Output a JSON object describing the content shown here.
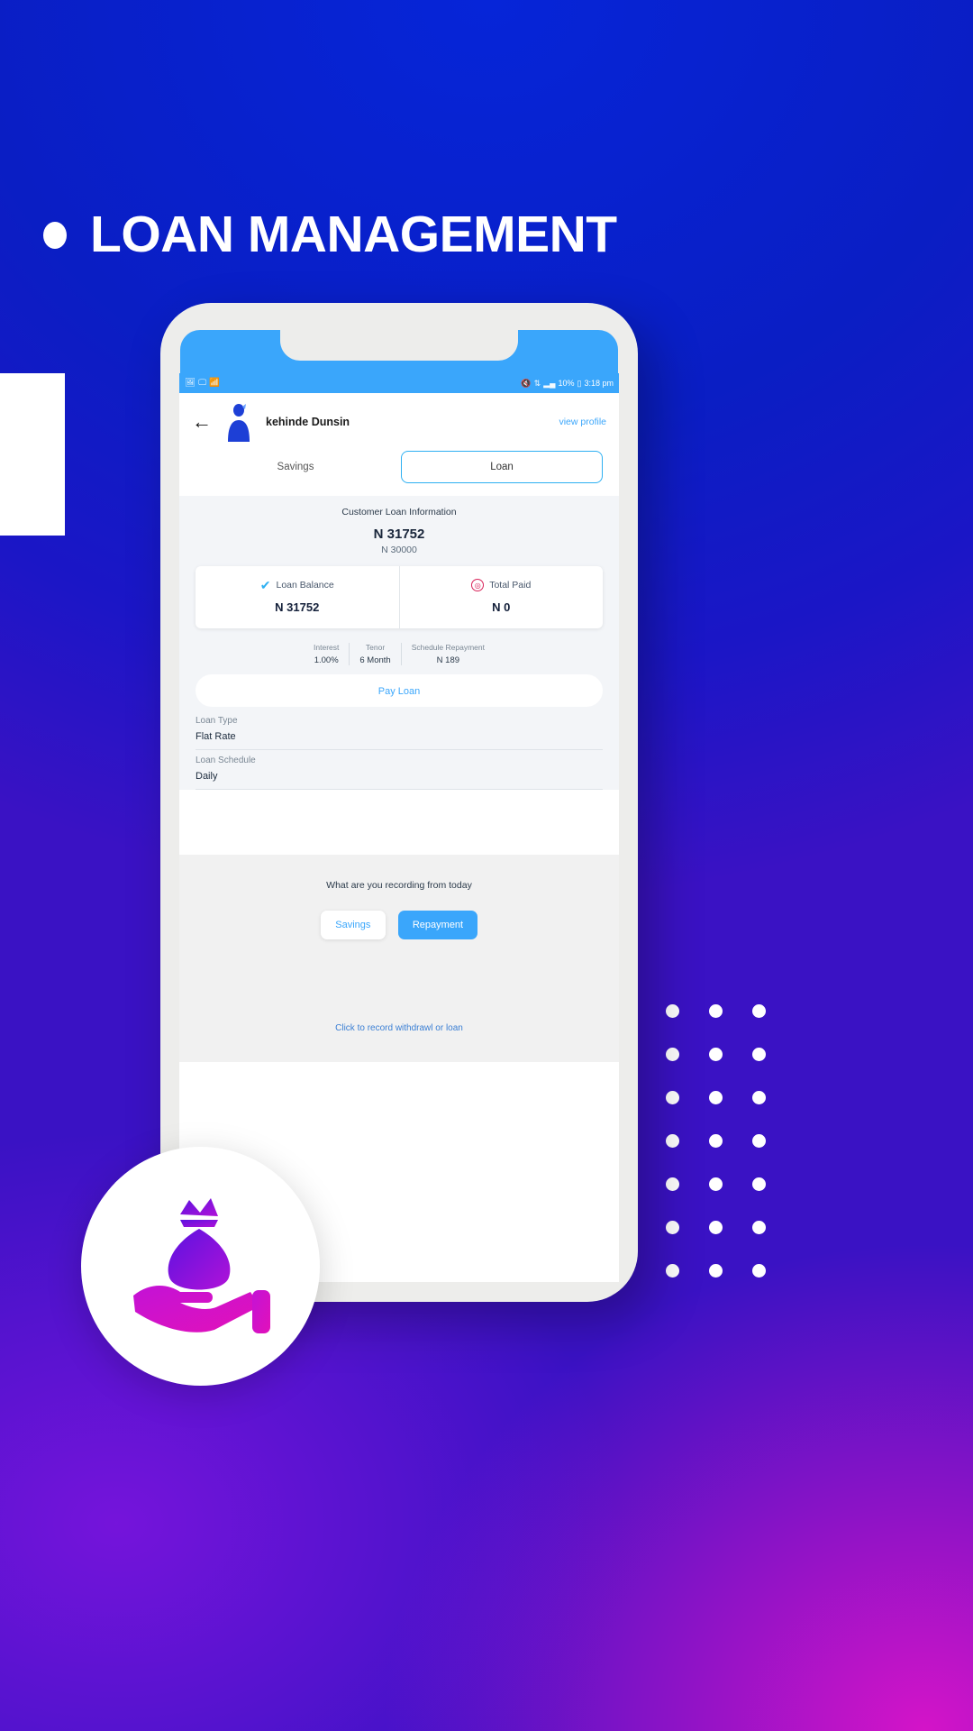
{
  "slide": {
    "title": "LOAN MANAGEMENT",
    "bullet": "•",
    "bg_color": "#0a1fcf",
    "accent_color": "#3aa6fb"
  },
  "phone": {
    "statusbar": {
      "left_icons": [
        "image-icon",
        "monitor-icon",
        "wifi-icon"
      ],
      "right_icons": [
        "mute-icon",
        "sync-icon",
        "signal-icon"
      ],
      "battery": "10%",
      "time": "3:18 pm"
    },
    "appbar": {
      "back_icon": "back-arrow-icon",
      "customer_name": "kehinde Dunsin",
      "view_profile": "view profile",
      "avatar": "avatar-icon"
    },
    "tabs": [
      {
        "label": "Savings",
        "active": false
      },
      {
        "label": "Loan",
        "active": true
      }
    ],
    "loan": {
      "section_title": "Customer Loan Information",
      "amount": "N 31752",
      "principal": "N 30000",
      "cards": [
        {
          "label": "Loan Balance",
          "value": "N 31752",
          "icon": "check-icon"
        },
        {
          "label": "Total Paid",
          "value": "N 0",
          "icon": "target-icon"
        }
      ],
      "meta": [
        {
          "label": "Interest",
          "value": "1.00%"
        },
        {
          "label": "Tenor",
          "value": "6 Month"
        },
        {
          "label": "Schedule Repayment",
          "value": "N 189"
        }
      ],
      "pay_loan": "Pay Loan",
      "fields": [
        {
          "label": "Loan Type",
          "value": "Flat Rate"
        },
        {
          "label": "Loan Schedule",
          "value": "Daily"
        }
      ]
    },
    "recording": {
      "prompt": "What are you recording from today",
      "buttons": [
        {
          "label": "Savings",
          "style": "light"
        },
        {
          "label": "Repayment",
          "style": "primary"
        }
      ],
      "link": "Click to record withdrawl or loan"
    }
  },
  "badge": {
    "icon": "money-bag-in-hand-icon"
  }
}
